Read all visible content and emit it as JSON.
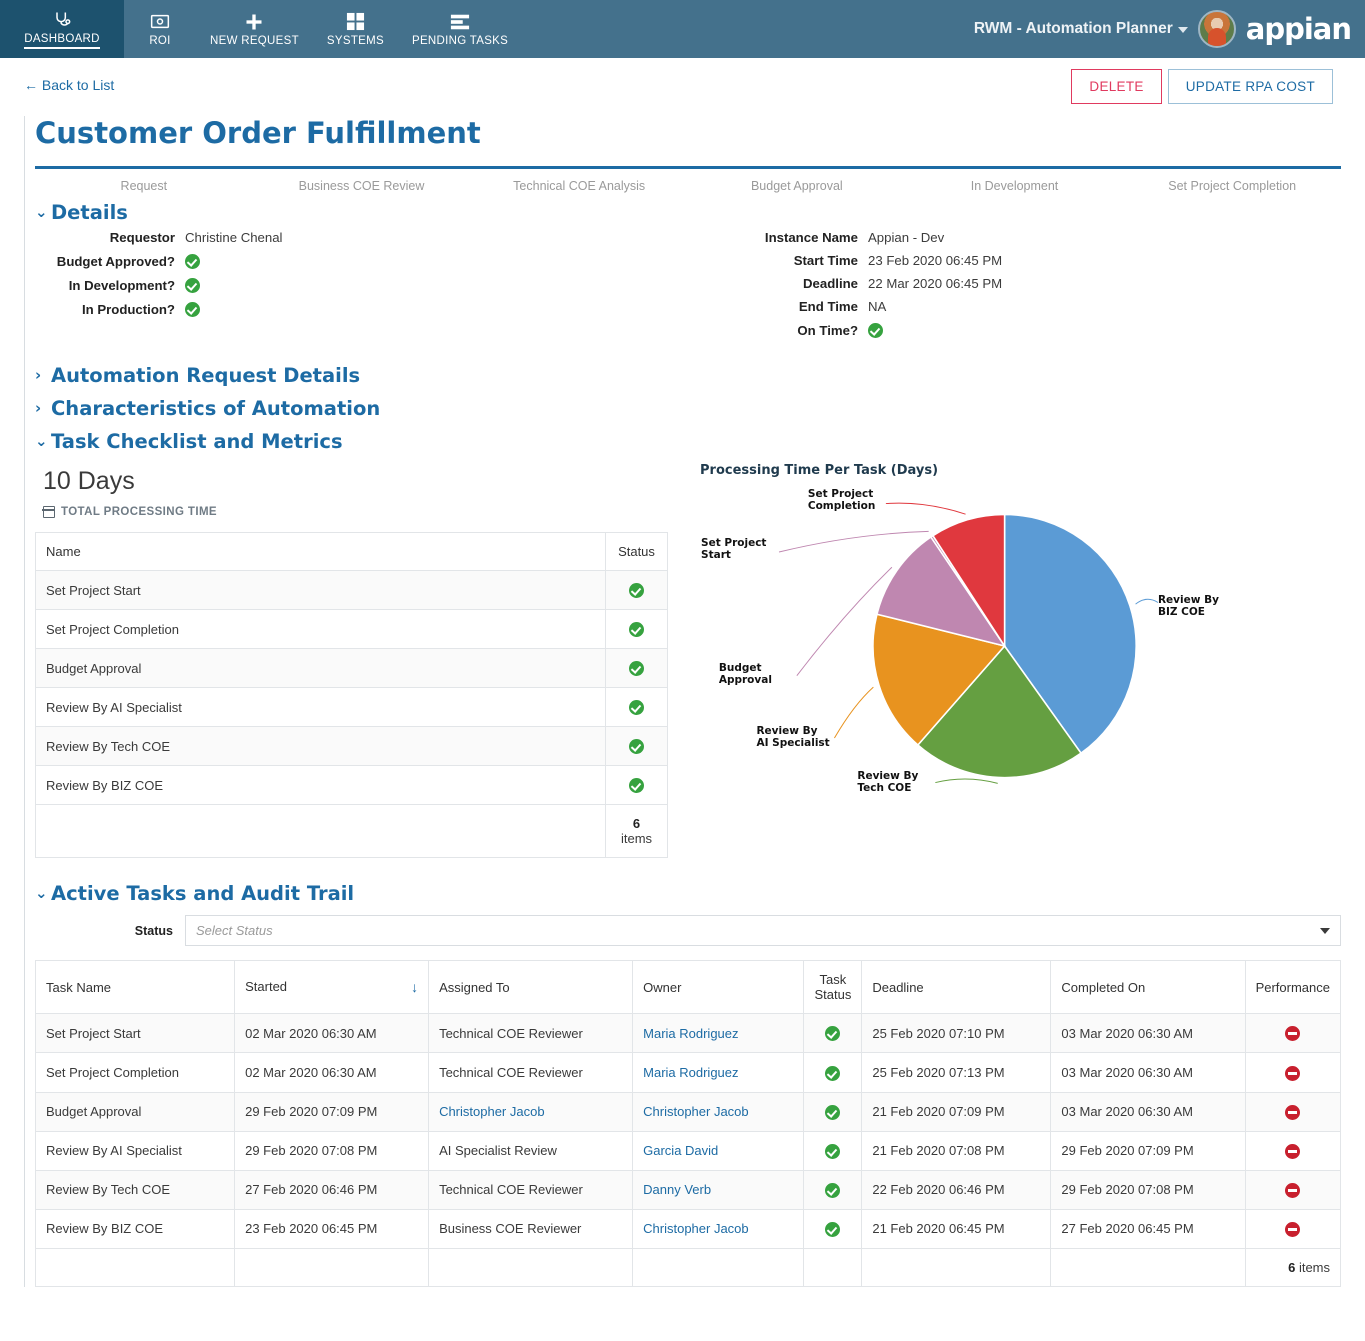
{
  "topnav": {
    "items": [
      {
        "label": "DASHBOARD",
        "icon": "stethoscope-icon",
        "active": true
      },
      {
        "label": "ROI",
        "icon": "money-icon",
        "active": false
      },
      {
        "label": "NEW REQUEST",
        "icon": "plus-icon",
        "active": false
      },
      {
        "label": "SYSTEMS",
        "icon": "grid-icon",
        "active": false
      },
      {
        "label": "PENDING TASKS",
        "icon": "list-icon",
        "active": false
      }
    ],
    "app_title": "RWM - Automation Planner",
    "brand": "appian",
    "accent_bg": "#44718c",
    "active_bg": "#1d526e"
  },
  "subbar": {
    "back_label": "← Back to List",
    "delete_label": "DELETE",
    "update_label": "UPDATE RPA COST",
    "delete_color": "#e03a5f",
    "update_color": "#1d6ba4"
  },
  "page_title": "Customer Order Fulfillment",
  "milestones": [
    "Request",
    "Business COE Review",
    "Technical COE Analysis",
    "Budget Approval",
    "In Development",
    "Set Project Completion"
  ],
  "sections": {
    "details": "Details",
    "automation_request_details": "Automation Request Details",
    "characteristics": "Characteristics of Automation",
    "task_checklist": "Task Checklist and Metrics",
    "active_tasks": "Active Tasks and Audit Trail"
  },
  "details": {
    "left": [
      {
        "label": "Requestor",
        "value": "Christine Chenal",
        "type": "text"
      },
      {
        "label": "Budget Approved?",
        "value": "",
        "type": "check"
      },
      {
        "label": "In Development?",
        "value": "",
        "type": "check"
      },
      {
        "label": "In Production?",
        "value": "",
        "type": "check"
      }
    ],
    "right": [
      {
        "label": "Instance Name",
        "value": "Appian - Dev",
        "type": "text"
      },
      {
        "label": "Start Time",
        "value": "23 Feb 2020 06:45 PM",
        "type": "text"
      },
      {
        "label": "Deadline",
        "value": "22 Mar 2020 06:45 PM",
        "type": "text"
      },
      {
        "label": "End Time",
        "value": "NA",
        "type": "text"
      },
      {
        "label": "On Time?",
        "value": "",
        "type": "check"
      }
    ]
  },
  "metrics": {
    "kpi_value": "10 Days",
    "kpi_label": "TOTAL PROCESSING TIME",
    "checklist": {
      "columns": [
        "Name",
        "Status"
      ],
      "rows": [
        {
          "name": "Set Project Start",
          "status": "check"
        },
        {
          "name": "Set Project Completion",
          "status": "check"
        },
        {
          "name": "Budget Approval",
          "status": "check"
        },
        {
          "name": "Review By AI Specialist",
          "status": "check"
        },
        {
          "name": "Review By Tech COE",
          "status": "check"
        },
        {
          "name": "Review By BIZ COE",
          "status": "check"
        }
      ],
      "footer_count": "6",
      "footer_label": " items"
    }
  },
  "chart_data": {
    "type": "pie",
    "title": "Processing Time Per Task (Days)",
    "ylabel": "",
    "xlabel": "",
    "legend_position": "labels-outside",
    "grid": false,
    "categories": [
      "Review By BIZ COE",
      "Review By Tech COE",
      "Review By AI Specialist",
      "Budget Approval",
      "Set Project Start",
      "Set Project Completion"
    ],
    "values": [
      4.03,
      2.14,
      1.75,
      1.17,
      0.03,
      0.92
    ],
    "percentages": [
      40.3,
      21.4,
      17.5,
      11.7,
      0.3,
      9.2
    ],
    "colors": [
      "#5b9bd5",
      "#659f41",
      "#e8931f",
      "#bf87b0",
      "#bf87b0",
      "#e0383e"
    ],
    "unit": "Days",
    "total": 10
  },
  "active_tasks": {
    "filter_label": "Status",
    "filter_placeholder": "Select Status",
    "columns": [
      "Task Name",
      "Started",
      "Assigned To",
      "Owner",
      "Task Status",
      "Deadline",
      "Completed On",
      "Performance"
    ],
    "sorted_column": "Started",
    "sort_direction": "↓",
    "rows": [
      {
        "task": "Set Project Start",
        "started": "02 Mar 2020 06:30 AM",
        "assigned": "Technical COE Reviewer",
        "assigned_link": false,
        "owner": "Maria Rodriguez",
        "status": "check",
        "deadline": "25 Feb 2020 07:10 PM",
        "completed": "03 Mar 2020 06:30 AM",
        "performance": "no"
      },
      {
        "task": "Set Project Completion",
        "started": "02 Mar 2020 06:30 AM",
        "assigned": "Technical COE Reviewer",
        "assigned_link": false,
        "owner": "Maria Rodriguez",
        "status": "check",
        "deadline": "25 Feb 2020 07:13 PM",
        "completed": "03 Mar 2020 06:30 AM",
        "performance": "no"
      },
      {
        "task": "Budget Approval",
        "started": "29 Feb 2020 07:09 PM",
        "assigned": "Christopher Jacob",
        "assigned_link": true,
        "owner": "Christopher Jacob",
        "status": "check",
        "deadline": "21 Feb 2020 07:09 PM",
        "completed": "03 Mar 2020 06:30 AM",
        "performance": "no"
      },
      {
        "task": "Review By AI Specialist",
        "started": "29 Feb 2020 07:08 PM",
        "assigned": "AI Specialist Review",
        "assigned_link": false,
        "owner": "Garcia David",
        "status": "check",
        "deadline": "21 Feb 2020 07:08 PM",
        "completed": "29 Feb 2020 07:09 PM",
        "performance": "no"
      },
      {
        "task": "Review By Tech COE",
        "started": "27 Feb 2020 06:46 PM",
        "assigned": "Technical COE Reviewer",
        "assigned_link": false,
        "owner": "Danny Verb",
        "status": "check",
        "deadline": "22 Feb 2020 06:46 PM",
        "completed": "29 Feb 2020 07:08 PM",
        "performance": "no"
      },
      {
        "task": "Review By BIZ COE",
        "started": "23 Feb 2020 06:45 PM",
        "assigned": "Business COE Reviewer",
        "assigned_link": false,
        "owner": "Christopher Jacob",
        "status": "check",
        "deadline": "21 Feb 2020 06:45 PM",
        "completed": "27 Feb 2020 06:45 PM",
        "performance": "no"
      }
    ],
    "footer_count": "6",
    "footer_label": " items"
  }
}
